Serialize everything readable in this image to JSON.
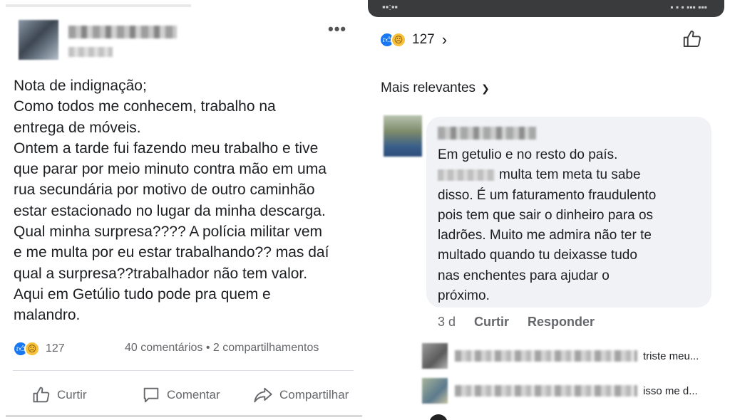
{
  "left_post": {
    "more_icon": "more-dots-icon",
    "lines": [
      "Nota de indignação;",
      "Como todos me conhecem, trabalho na",
      "entrega de móveis.",
      "Ontem a tarde fui fazendo meu trabalho e tive",
      "que parar por meio minuto contra mão em uma",
      "rua secundária por motivo de outro caminhão",
      "estar estacionado no lugar da minha descarga.",
      "Qual minha surpresa???? A polícia militar vem",
      "e me multa por eu estar trabalhando?? mas daí",
      "qual a surpresa??trabalhador não tem valor.",
      "Aqui em Getúlio tudo pode pra quem e",
      "malandro."
    ],
    "reaction_count": "127",
    "comments_shares": "40 comentários • 2 compartilhamentos",
    "actions": {
      "like": "Curtir",
      "comment": "Comentar",
      "share": "Compartilhar"
    }
  },
  "right_panel": {
    "reaction_count": "127",
    "chevron": "›",
    "sort_label": "Mais relevantes",
    "comment": {
      "lines": [
        "Em getulio e no resto do país.",
        "multa tem meta tu sabe",
        "disso. É um faturamento fraudulento",
        "pois tem que sair o dinheiro para os",
        "ladrões. Muito me admira não ter te",
        "multado quando tu deixasse tudo",
        "nas enchentes para ajudar o",
        "próximo."
      ],
      "time": "3 d",
      "like": "Curtir",
      "reply": "Responder"
    },
    "replies": [
      {
        "text": "triste meu..."
      },
      {
        "text": "isso me d..."
      }
    ]
  },
  "colors": {
    "like_blue": "#1877f2",
    "sad_yellow": "#f7c13c",
    "secondary_text": "#65676b",
    "bubble_bg": "#f0f2f5"
  }
}
